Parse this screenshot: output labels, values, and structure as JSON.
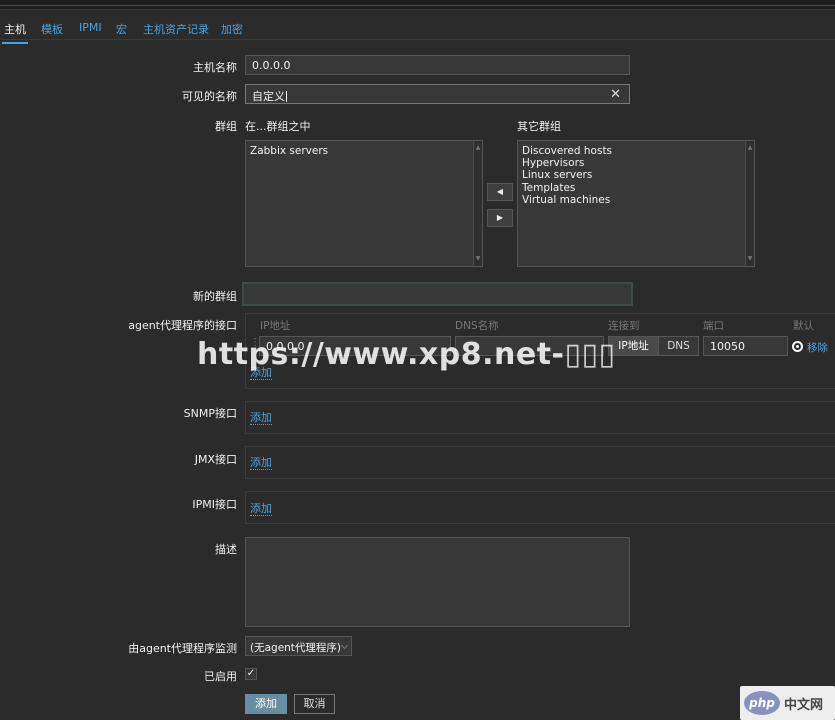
{
  "tabs": [
    "主机",
    "模板",
    "IPMI",
    "宏",
    "主机资产记录",
    "加密"
  ],
  "form": {
    "host_name_label": "主机名称",
    "host_name_value": "0.0.0.0",
    "visible_name_label": "可见的名称",
    "visible_name_value": "自定义",
    "groups_label": "群组",
    "in_groups_label": "在...群组之中",
    "other_groups_label": "其它群组",
    "in_groups": [
      "Zabbix servers"
    ],
    "other_groups": [
      "Discovered hosts",
      "Hypervisors",
      "Linux servers",
      "Templates",
      "Virtual machines"
    ],
    "new_group_label": "新的群组",
    "new_group_value": "",
    "agent_interfaces_label": "agent代理程序的接口",
    "interface_columns": {
      "ip": "IP地址",
      "dns": "DNS名称",
      "connect": "连接到",
      "port": "端口",
      "default": "默认"
    },
    "agent_interface": {
      "ip": "0.0.0.0",
      "dns": "",
      "connect_ip": "IP地址",
      "connect_dns": "DNS",
      "port": "10050",
      "remove": "移除"
    },
    "add_link": "添加",
    "snmp_label": "SNMP接口",
    "jmx_label": "JMX接口",
    "ipmi_label": "IPMI接口",
    "description_label": "描述",
    "description_value": "",
    "monitored_by_label": "由agent代理程序监测",
    "monitored_by_value": "(无agent代理程序)",
    "enabled_label": "已启用",
    "enabled_check": "✓",
    "add_button": "添加",
    "cancel_button": "取消"
  },
  "watermark": "https://www.xp8.net-",
  "logo": {
    "php": "php",
    "cn": "中文网"
  }
}
